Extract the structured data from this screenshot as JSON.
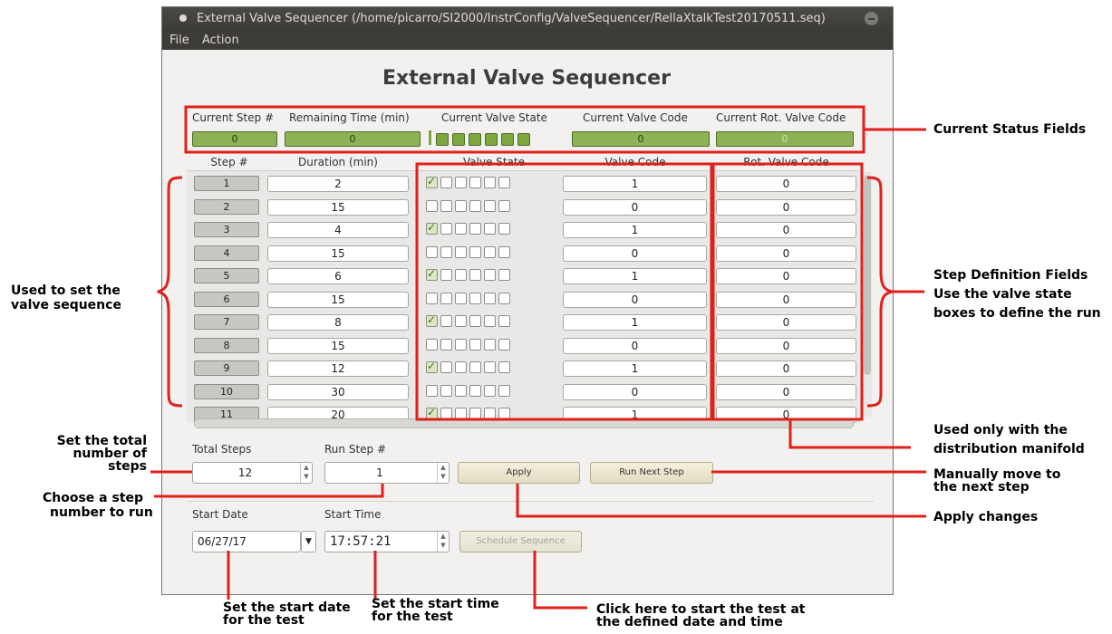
{
  "window": {
    "title": "External Valve Sequencer (/home/picarro/SI2000/InstrConfig/ValveSequencer/RellaXtalkTest20170511.seq)",
    "menu": [
      "File",
      "Action"
    ]
  },
  "heading": "External Valve Sequencer",
  "status": {
    "current_step_label": "Current Step #",
    "current_step_value": "0",
    "remaining_time_label": "Remaining Time (min)",
    "remaining_time_value": "0",
    "valve_state_label": "Current Valve State",
    "valve_code_label": "Current Valve Code",
    "valve_code_value": "0",
    "rot_valve_label": "Current Rot. Valve Code",
    "rot_valve_value": "0"
  },
  "table": {
    "headers": {
      "step": "Step #",
      "duration": "Duration (min)",
      "valve_state": "Valve State",
      "valve_code": "Valve Code",
      "rot_valve_code": "Rot. Valve Code"
    },
    "rows": [
      {
        "step": "1",
        "duration": "2",
        "valve1_on": true,
        "valve_code": "1",
        "rot": "0"
      },
      {
        "step": "2",
        "duration": "15",
        "valve1_on": false,
        "valve_code": "0",
        "rot": "0"
      },
      {
        "step": "3",
        "duration": "4",
        "valve1_on": true,
        "valve_code": "1",
        "rot": "0"
      },
      {
        "step": "4",
        "duration": "15",
        "valve1_on": false,
        "valve_code": "0",
        "rot": "0"
      },
      {
        "step": "5",
        "duration": "6",
        "valve1_on": true,
        "valve_code": "1",
        "rot": "0"
      },
      {
        "step": "6",
        "duration": "15",
        "valve1_on": false,
        "valve_code": "0",
        "rot": "0"
      },
      {
        "step": "7",
        "duration": "8",
        "valve1_on": true,
        "valve_code": "1",
        "rot": "0"
      },
      {
        "step": "8",
        "duration": "15",
        "valve1_on": false,
        "valve_code": "0",
        "rot": "0"
      },
      {
        "step": "9",
        "duration": "12",
        "valve1_on": true,
        "valve_code": "1",
        "rot": "0"
      },
      {
        "step": "10",
        "duration": "30",
        "valve1_on": false,
        "valve_code": "0",
        "rot": "0"
      },
      {
        "step": "11",
        "duration": "20",
        "valve1_on": true,
        "valve_code": "1",
        "rot": "0"
      }
    ]
  },
  "controls": {
    "total_steps_label": "Total Steps",
    "total_steps_value": "12",
    "run_step_label": "Run Step #",
    "run_step_value": "1",
    "apply_label": "Apply",
    "run_next_label": "Run Next Step",
    "start_date_label": "Start Date",
    "start_date_value": "06/27/17",
    "start_time_label": "Start Time",
    "start_time_value": "17:57:21",
    "schedule_label": "Schedule Sequence"
  },
  "annotations": {
    "current_status": "Current Status Fields",
    "set_sequence": [
      "Used to set the",
      "valve sequence"
    ],
    "step_definition": [
      "Step Definition Fields",
      "Use the valve state",
      "boxes to define the run"
    ],
    "distribution": [
      "Used only with the",
      "distribution manifold"
    ],
    "total_steps": [
      "Set the total",
      "number of",
      "steps"
    ],
    "choose_step": [
      "Choose a step",
      "number to run"
    ],
    "manual_move": [
      "Manually move to",
      "the next step"
    ],
    "apply_changes": "Apply changes",
    "start_date": [
      "Set the start date",
      "for the test"
    ],
    "start_time": [
      "Set the start time",
      "for the test"
    ],
    "schedule": [
      "Click here to start the test at",
      "the defined date and time"
    ]
  },
  "colors": {
    "annotation_red": "#e0201b",
    "status_green": "#8db255",
    "title_bar": "#3c3b37"
  }
}
